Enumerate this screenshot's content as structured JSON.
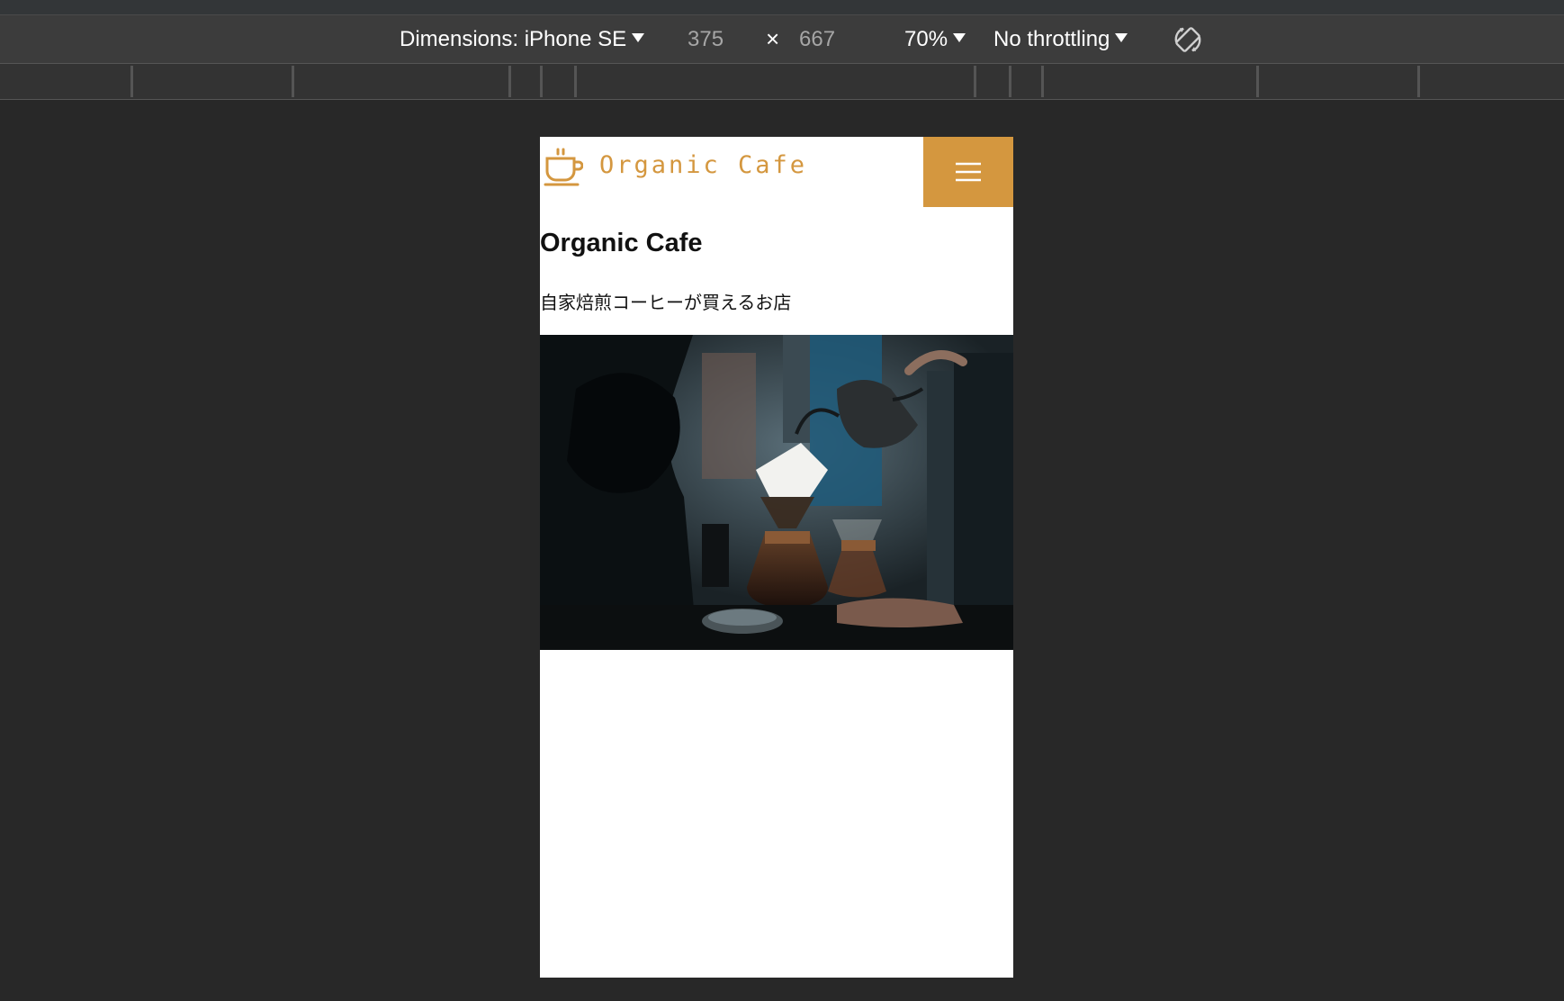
{
  "devtools": {
    "dimensions_label": "Dimensions: iPhone SE",
    "width_value": "375",
    "times": "×",
    "height_value": "667",
    "zoom": "70%",
    "throttling": "No throttling",
    "rotate_icon": "rotate-icon"
  },
  "site": {
    "logo_text": "Organic Cafe",
    "logo_icon": "coffee-cup-icon",
    "menu_icon": "hamburger-menu-icon",
    "brand_color": "#d4973f",
    "hero_title": "Organic Cafe",
    "hero_subtitle": "自家焙煎コーヒーが買えるお店",
    "hero_image": "coffee-pour-over-photo"
  }
}
